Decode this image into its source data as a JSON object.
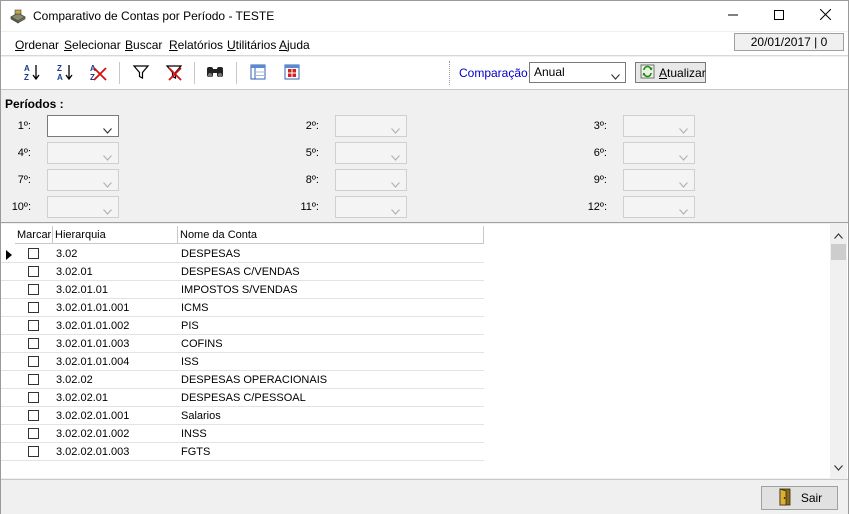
{
  "window": {
    "title": "Comparativo de Contas por Período  - TESTE",
    "minimize_glyph": "—",
    "maximize_glyph": "☐",
    "close_glyph": "✕"
  },
  "menu": {
    "items": [
      {
        "first": "O",
        "rest": "rdenar"
      },
      {
        "first": "S",
        "rest": "elecionar"
      },
      {
        "first": "B",
        "rest": "uscar"
      },
      {
        "first": "R",
        "rest": "elatórios"
      },
      {
        "first": "U",
        "rest": "tilitários"
      },
      {
        "first": "A",
        "rest": "juda"
      }
    ],
    "status_date": "20/01/2017 | 0"
  },
  "toolbar": {
    "icons": [
      "sort-ascending-icon",
      "sort-descending-icon",
      "clear-sort-icon",
      "filter-icon",
      "clear-filter-icon",
      "binoculars-icon",
      "column-layout-icon",
      "grid-settings-icon"
    ],
    "comparison_label": "Comparação:",
    "comparison_value": "Anual",
    "refresh_label_first": "A",
    "refresh_label_rest": "tualizar"
  },
  "periods": {
    "title": "Períodos :",
    "labels": [
      "1º:",
      "2º:",
      "3º:",
      "4º:",
      "5º:",
      "6º:",
      "7º:",
      "8º:",
      "9º:",
      "10º:",
      "11º:",
      "12º:"
    ]
  },
  "grid": {
    "columns": [
      "Marcar",
      "Hierarquia",
      "Nome da Conta"
    ],
    "rows": [
      {
        "hierarchy": "3.02",
        "name": "DESPESAS"
      },
      {
        "hierarchy": "3.02.01",
        "name": "DESPESAS C/VENDAS"
      },
      {
        "hierarchy": "3.02.01.01",
        "name": "IMPOSTOS S/VENDAS"
      },
      {
        "hierarchy": "3.02.01.01.001",
        "name": "ICMS"
      },
      {
        "hierarchy": "3.02.01.01.002",
        "name": "PIS"
      },
      {
        "hierarchy": "3.02.01.01.003",
        "name": "COFINS"
      },
      {
        "hierarchy": "3.02.01.01.004",
        "name": "ISS"
      },
      {
        "hierarchy": "3.02.02",
        "name": "DESPESAS OPERACIONAIS"
      },
      {
        "hierarchy": "3.02.02.01",
        "name": "DESPESAS C/PESSOAL"
      },
      {
        "hierarchy": "3.02.02.01.001",
        "name": "Salarios"
      },
      {
        "hierarchy": "3.02.02.01.002",
        "name": "INSS"
      },
      {
        "hierarchy": "3.02.02.01.003",
        "name": "FGTS"
      }
    ]
  },
  "footer": {
    "exit_label": "Sair"
  },
  "colors": {
    "accent_blue": "#0000c8"
  }
}
